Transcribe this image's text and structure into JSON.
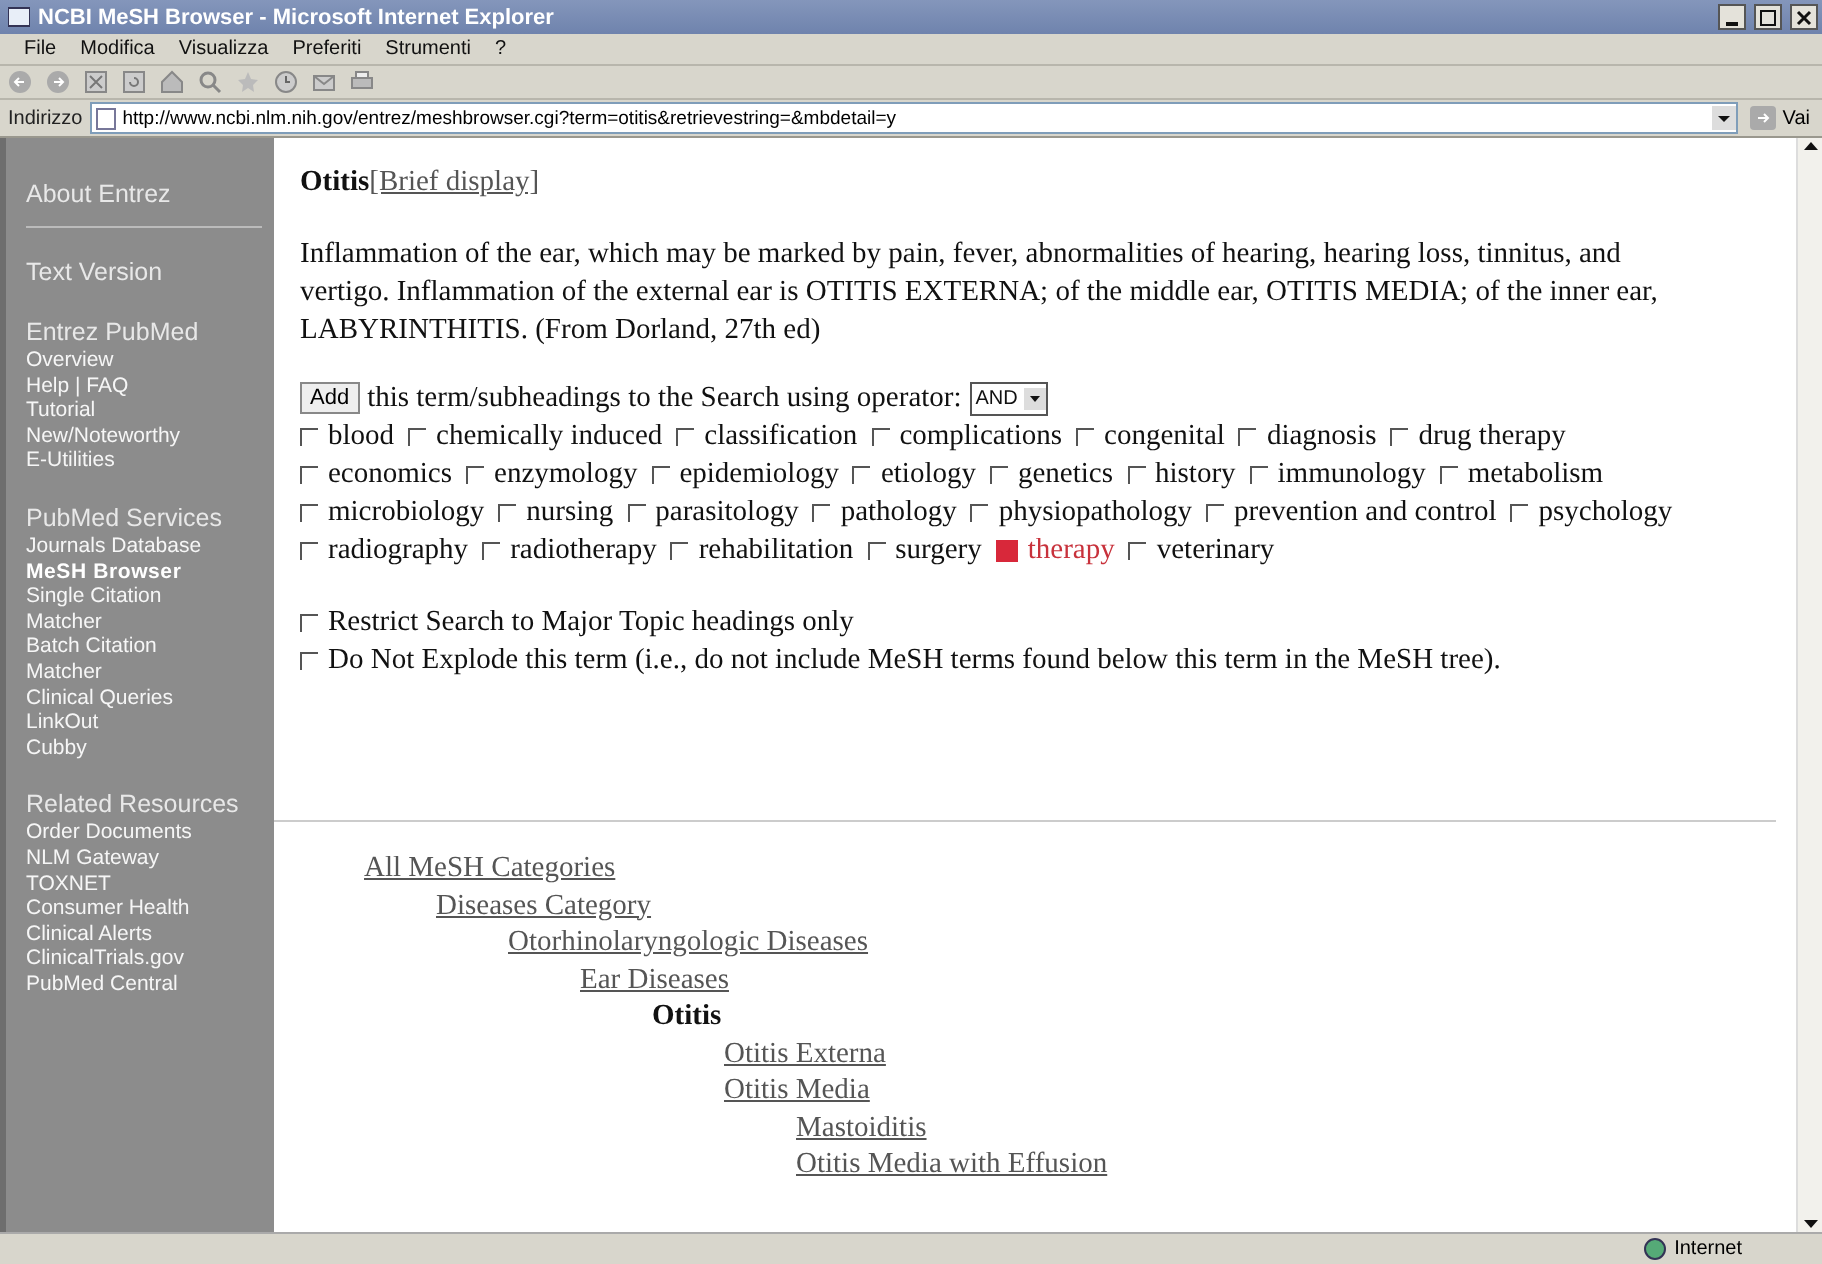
{
  "window": {
    "title": "NCBI MeSH Browser - Microsoft Internet Explorer"
  },
  "menu": [
    "File",
    "Modifica",
    "Visualizza",
    "Preferiti",
    "Strumenti",
    "?"
  ],
  "address": {
    "label": "Indirizzo",
    "url": "http://www.ncbi.nlm.nih.gov/entrez/meshbrowser.cgi?term=otitis&retrievestring=&mbdetail=y",
    "go": "Vai"
  },
  "sidebar": {
    "sections": [
      {
        "heading": "About Entrez"
      },
      {
        "heading": "Text Version"
      },
      {
        "heading": "Entrez PubMed",
        "items": [
          {
            "label": "Overview",
            "selected": false
          },
          {
            "label": "Help | FAQ",
            "selected": false
          },
          {
            "label": "Tutorial",
            "selected": false
          },
          {
            "label": "New/Noteworthy",
            "selected": false
          },
          {
            "label": "E-Utilities",
            "selected": false
          }
        ]
      },
      {
        "heading": "PubMed Services",
        "items": [
          {
            "label": "Journals Database",
            "selected": false
          },
          {
            "label": "MeSH Browser",
            "selected": true
          },
          {
            "label": "Single Citation Matcher",
            "selected": false
          },
          {
            "label": "Batch Citation Matcher",
            "selected": false
          },
          {
            "label": "Clinical Queries",
            "selected": false
          },
          {
            "label": "LinkOut",
            "selected": false
          },
          {
            "label": "Cubby",
            "selected": false
          }
        ]
      },
      {
        "heading": "Related Resources",
        "items": [
          {
            "label": "Order Documents",
            "selected": false
          },
          {
            "label": "NLM Gateway",
            "selected": false
          },
          {
            "label": "TOXNET",
            "selected": false
          },
          {
            "label": "Consumer Health",
            "selected": false
          },
          {
            "label": "Clinical Alerts",
            "selected": false
          },
          {
            "label": "ClinicalTrials.gov",
            "selected": false
          },
          {
            "label": "PubMed Central",
            "selected": false
          }
        ]
      }
    ]
  },
  "content": {
    "term": "Otitis",
    "brief_link": "[Brief display]",
    "definition": "Inflammation of the ear, which may be marked by pain, fever, abnormalities of hearing, hearing loss, tinnitus, and vertigo. Inflammation of the external ear is OTITIS EXTERNA; of the middle ear, OTITIS MEDIA; of the inner ear, LABYRINTHITIS. (From Dorland, 27th ed)",
    "add_button": "Add",
    "operator_text": "this term/subheadings to the Search using operator:",
    "operator_value": "AND",
    "subheadings": [
      {
        "label": "blood",
        "checked": false
      },
      {
        "label": "chemically induced",
        "checked": false
      },
      {
        "label": "classification",
        "checked": false
      },
      {
        "label": "complications",
        "checked": false
      },
      {
        "label": "congenital",
        "checked": false
      },
      {
        "label": "diagnosis",
        "checked": false
      },
      {
        "label": "drug therapy",
        "checked": false
      },
      {
        "label": "economics",
        "checked": false
      },
      {
        "label": "enzymology",
        "checked": false
      },
      {
        "label": "epidemiology",
        "checked": false
      },
      {
        "label": "etiology",
        "checked": false
      },
      {
        "label": "genetics",
        "checked": false
      },
      {
        "label": "history",
        "checked": false
      },
      {
        "label": "immunology",
        "checked": false
      },
      {
        "label": "metabolism",
        "checked": false
      },
      {
        "label": "microbiology",
        "checked": false
      },
      {
        "label": "nursing",
        "checked": false
      },
      {
        "label": "parasitology",
        "checked": false
      },
      {
        "label": "pathology",
        "checked": false
      },
      {
        "label": "physiopathology",
        "checked": false
      },
      {
        "label": "prevention and control",
        "checked": false
      },
      {
        "label": "psychology",
        "checked": false
      },
      {
        "label": "radiography",
        "checked": false
      },
      {
        "label": "radiotherapy",
        "checked": false
      },
      {
        "label": "rehabilitation",
        "checked": false
      },
      {
        "label": "surgery",
        "checked": false
      },
      {
        "label": "therapy",
        "checked": true
      },
      {
        "label": "veterinary",
        "checked": false
      }
    ],
    "options": [
      {
        "label": "Restrict Search to Major Topic headings only",
        "checked": false
      },
      {
        "label": "Do Not Explode this term (i.e., do not include MeSH terms found below this term in the MeSH tree).",
        "checked": false
      }
    ],
    "tree": [
      {
        "label": "All MeSH Categories",
        "current": false,
        "children": [
          {
            "label": "Diseases Category",
            "current": false,
            "children": [
              {
                "label": "Otorhinolaryngologic Diseases",
                "current": false,
                "children": [
                  {
                    "label": "Ear Diseases",
                    "current": false,
                    "children": [
                      {
                        "label": "Otitis",
                        "current": true,
                        "children": [
                          {
                            "label": "Otitis Externa",
                            "current": false
                          },
                          {
                            "label": "Otitis Media",
                            "current": false,
                            "children": [
                              {
                                "label": "Mastoiditis",
                                "current": false
                              },
                              {
                                "label": "Otitis Media with Effusion",
                                "current": false
                              }
                            ]
                          }
                        ]
                      }
                    ]
                  }
                ]
              }
            ]
          }
        ]
      }
    ]
  },
  "status_bar": {
    "zone": "Internet"
  }
}
